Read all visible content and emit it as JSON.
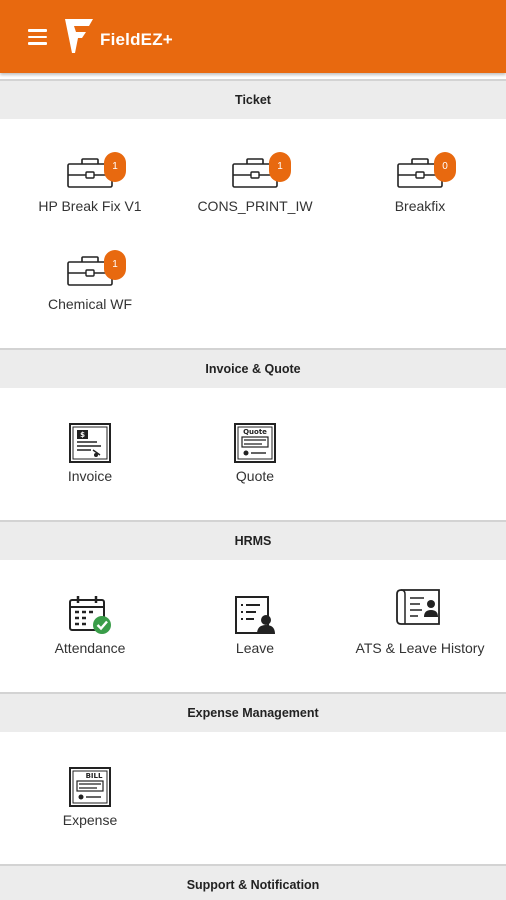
{
  "app": {
    "title": "FieldEZ+"
  },
  "sections": {
    "ticket": {
      "title": "Ticket",
      "items": [
        {
          "label": "HP Break Fix V1",
          "count": "1"
        },
        {
          "label": "CONS_PRINT_IW",
          "count": "1"
        },
        {
          "label": "Breakfix",
          "count": "0"
        },
        {
          "label": "Chemical WF",
          "count": "1"
        }
      ]
    },
    "invoice": {
      "title": "Invoice & Quote",
      "items": [
        {
          "label": "Invoice",
          "icon": "invoice-icon"
        },
        {
          "label": "Quote",
          "icon": "quote-icon",
          "icon_text": "Quote"
        }
      ]
    },
    "hrms": {
      "title": "HRMS",
      "items": [
        {
          "label": "Attendance",
          "icon": "attendance-icon"
        },
        {
          "label": "Leave",
          "icon": "leave-icon"
        },
        {
          "label": "ATS & Leave History",
          "icon": "ats-history-icon"
        }
      ]
    },
    "expense": {
      "title": "Expense Management",
      "items": [
        {
          "label": "Expense",
          "icon": "expense-icon",
          "icon_text": "BILL"
        }
      ]
    },
    "support": {
      "title": "Support & Notification"
    }
  },
  "colors": {
    "accent": "#e8690f",
    "header_bg": "#ececec"
  }
}
